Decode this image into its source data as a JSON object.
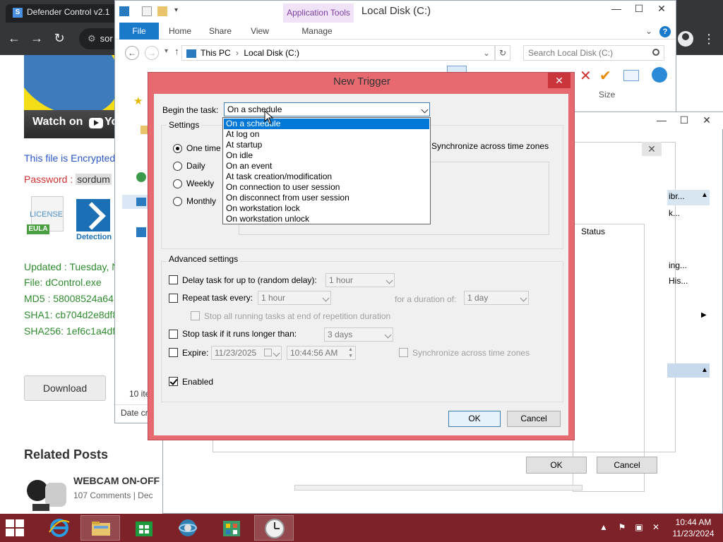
{
  "browser": {
    "tab_title": "Defender Control v2.1",
    "address_fragment": "sor",
    "video": {
      "watch_on": "Watch on",
      "yt_fragment": "Yo"
    },
    "encrypted_text": "This file is Encrypted",
    "password_label": "Password :",
    "password_value": "sordum",
    "license_text": "LICENSE",
    "eula_text": "EULA",
    "detection_text": "Detection",
    "updated": "Updated : Tuesday, N",
    "file": "File: dControl.exe",
    "md5": "MD5 : 58008524a64",
    "sha1": "SHA1: cb704d2e8df8",
    "sha256": "SHA256: 1ef6c1a4df",
    "download_label": "Download",
    "related_posts": "Related Posts",
    "webcam_title": "WEBCAM ON-OFF",
    "webcam_meta": "107 Comments  |  Dec"
  },
  "explorer": {
    "title": "Local Disk (C:)",
    "app_tools": "Application Tools",
    "tabs": [
      "File",
      "Home",
      "Share",
      "View",
      "Manage"
    ],
    "breadcrumb": [
      "This PC",
      "Local Disk (C:)"
    ],
    "search_placeholder": "Search Local Disk (C:)",
    "size_col": "Size",
    "status": "10 ite",
    "date_col": "Date cr"
  },
  "scheduler": {
    "right_pane": [
      "ibr...",
      "k...",
      "ing...",
      "His..."
    ],
    "status_col": "Status",
    "ok": "OK",
    "cancel": "Cancel"
  },
  "dialog": {
    "title": "New Trigger",
    "begin_label": "Begin the task:",
    "begin_value": "On a schedule",
    "settings_label": "Settings",
    "schedule_options": [
      {
        "label": "One time",
        "checked": true
      },
      {
        "label": "Daily",
        "checked": false
      },
      {
        "label": "Weekly",
        "checked": false
      },
      {
        "label": "Monthly",
        "checked": false
      }
    ],
    "sync_tz": "Synchronize across time zones",
    "dropdown_options": [
      "On a schedule",
      "At log on",
      "At startup",
      "On idle",
      "On an event",
      "At task creation/modification",
      "On connection to user session",
      "On disconnect from user session",
      "On workstation lock",
      "On workstation unlock"
    ],
    "advanced_label": "Advanced settings",
    "delay_label": "Delay task for up to (random delay):",
    "delay_value": "1 hour",
    "repeat_label": "Repeat task every:",
    "repeat_value": "1 hour",
    "duration_label": "for a duration of:",
    "duration_value": "1 day",
    "stop_running_label": "Stop all running tasks at end of repetition duration",
    "stop_longer_label": "Stop task if it runs longer than:",
    "stop_longer_value": "3 days",
    "expire_label": "Expire:",
    "expire_date": "11/23/2025",
    "expire_time": "10:44:56 AM",
    "expire_sync": "Synchronize across time zones",
    "enabled_label": "Enabled",
    "enabled_checked": true,
    "ok": "OK",
    "cancel": "Cancel"
  },
  "taskbar": {
    "time": "10:44 AM",
    "date": "11/23/2024"
  },
  "colors": {
    "dialog_border": "#e76a70",
    "selection": "#0078d7",
    "taskbar": "#7d2228"
  }
}
